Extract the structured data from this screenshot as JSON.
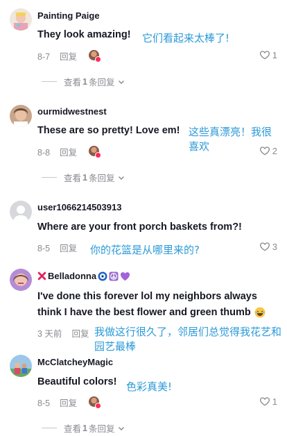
{
  "colors": {
    "translation": "#2b9ad8",
    "meta": "#8a8b91",
    "text": "#161823",
    "like_badge": "#fe2c55"
  },
  "comments": [
    {
      "username": "Painting Paige",
      "text": "They look amazing!",
      "translation": "它们看起来太棒了!",
      "date": "8-7",
      "reply_label": "回复",
      "likes": "1",
      "view_replies": {
        "prefix": "查看",
        "count": "1",
        "suffix": "条回复"
      }
    },
    {
      "username": "ourmidwestnest",
      "text": "These are so pretty! Love em!",
      "translation": "这些真漂亮！我很喜欢",
      "date": "8-8",
      "reply_label": "回复",
      "likes": "2",
      "view_replies": {
        "prefix": "查看",
        "count": "1",
        "suffix": "条回复"
      }
    },
    {
      "username": "user1066214503913",
      "text": "Where are your front porch baskets from?!",
      "translation": "你的花篮是从哪里来的?",
      "date": "8-5",
      "reply_label": "回复",
      "likes": "3"
    },
    {
      "username": "Belladonna",
      "username_emojis": [
        "cross-mark-icon",
        "nazar-amulet-icon",
        "peace-symbol-icon",
        "purple-heart-icon"
      ],
      "text_line1": "I've done this forever lol my neighbors always",
      "text_line2": "think I have the best flower and green thumb",
      "translation": "我做这行很久了，邻居们总觉得我花艺和园艺最棒",
      "date": "3 天前",
      "reply_label": "回复"
    },
    {
      "username": "McClatcheyMagic",
      "text": "Beautiful colors!",
      "translation": "色彩真美!",
      "date": "8-5",
      "reply_label": "回复",
      "likes": "1",
      "view_replies": {
        "prefix": "查看",
        "count": "1",
        "suffix": "条回复"
      }
    }
  ]
}
